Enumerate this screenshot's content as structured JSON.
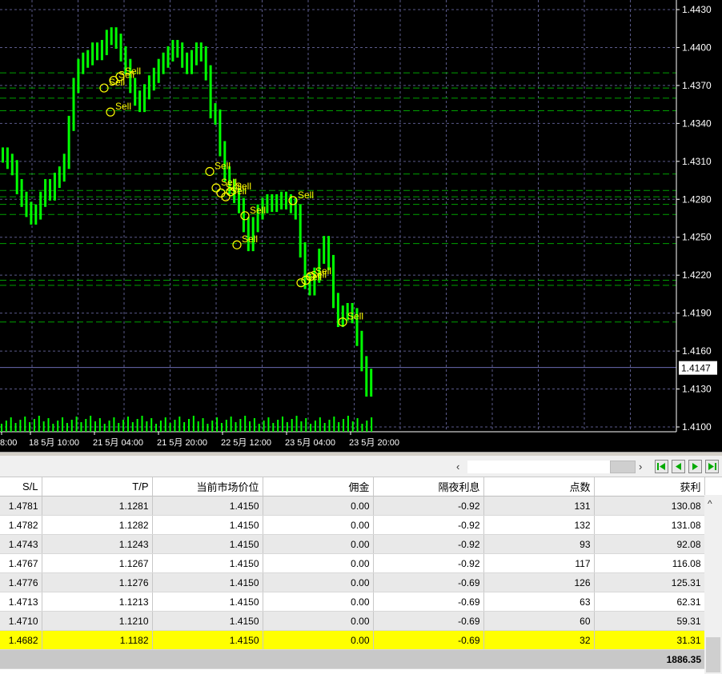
{
  "chart": {
    "price_ticks": [
      "1.4430",
      "1.4400",
      "1.4370",
      "1.4340",
      "1.4310",
      "1.4280",
      "1.4250",
      "1.4220",
      "1.4190",
      "1.4160",
      "1.4130",
      "1.4100"
    ],
    "current_price": "1.4147",
    "time_labels": [
      "8:00",
      "18 5月 10:00",
      "21 5月 04:00",
      "21 5月 20:00",
      "22 5月 12:00",
      "23 5月 04:00",
      "23 5月 20:00"
    ],
    "sell_label": "Sell",
    "colors": {
      "background": "#000000",
      "candles": "#00ff00",
      "grid": "#5a5a8a",
      "levels": "#00a000",
      "markers": "#ffff00",
      "axis_text": "#ffffff"
    }
  },
  "chart_data": {
    "type": "line",
    "ylim": [
      1.41,
      1.4445
    ],
    "prices": [
      1.4315,
      1.431,
      1.4305,
      1.429,
      1.428,
      1.4272,
      1.4266,
      1.427,
      1.428,
      1.429,
      1.4285,
      1.4295,
      1.43,
      1.431,
      1.434,
      1.437,
      1.4385,
      1.439,
      1.4392,
      1.4398,
      1.4396,
      1.44,
      1.4408,
      1.441,
      1.4405,
      1.4395,
      1.4385,
      1.437,
      1.436,
      1.4355,
      1.4365,
      1.4372,
      1.4378,
      1.4385,
      1.439,
      1.4395,
      1.44,
      1.4398,
      1.439,
      1.4385,
      1.4392,
      1.4398,
      1.4395,
      1.438,
      1.435,
      1.4345,
      1.432,
      1.43,
      1.429,
      1.4283,
      1.4275,
      1.426,
      1.4245,
      1.426,
      1.427,
      1.4275,
      1.4278,
      1.4276,
      1.4278,
      1.428,
      1.4278,
      1.4275,
      1.427,
      1.424,
      1.4215,
      1.421,
      1.422,
      1.4235,
      1.4245,
      1.423,
      1.42,
      1.4185,
      1.419,
      1.4192,
      1.4188,
      1.417,
      1.415,
      1.413,
      1.414
    ],
    "sell_levels": [
      1.4368,
      1.4374,
      1.4377,
      1.4349,
      1.4302,
      1.4289,
      1.4285,
      1.4282,
      1.4286,
      1.4267,
      1.4244,
      1.4279,
      1.4214,
      1.4216,
      1.4219,
      1.4183
    ],
    "level_lines": [
      1.438,
      1.4368,
      1.436,
      1.435,
      1.43,
      1.4287,
      1.4282,
      1.4276,
      1.4268,
      1.4245,
      1.4216,
      1.4212,
      1.4183
    ],
    "current_price": 1.4147
  },
  "table": {
    "headers": [
      "S/L",
      "T/P",
      "当前市场价位",
      "佣金",
      "隔夜利息",
      "点数",
      "获利"
    ],
    "rows": [
      [
        "1.4781",
        "1.1281",
        "1.4150",
        "0.00",
        "-0.92",
        "131",
        "130.08"
      ],
      [
        "1.4782",
        "1.1282",
        "1.4150",
        "0.00",
        "-0.92",
        "132",
        "131.08"
      ],
      [
        "1.4743",
        "1.1243",
        "1.4150",
        "0.00",
        "-0.92",
        "93",
        "92.08"
      ],
      [
        "1.4767",
        "1.1267",
        "1.4150",
        "0.00",
        "-0.92",
        "117",
        "116.08"
      ],
      [
        "1.4776",
        "1.1276",
        "1.4150",
        "0.00",
        "-0.69",
        "126",
        "125.31"
      ],
      [
        "1.4713",
        "1.1213",
        "1.4150",
        "0.00",
        "-0.69",
        "63",
        "62.31"
      ],
      [
        "1.4710",
        "1.1210",
        "1.4150",
        "0.00",
        "-0.69",
        "60",
        "59.31"
      ],
      [
        "1.4682",
        "1.1182",
        "1.4150",
        "0.00",
        "-0.69",
        "32",
        "31.31"
      ]
    ],
    "total": "1886.35",
    "highlight_color": "#ffff00"
  },
  "scrollbar": {
    "left_arrow": "‹",
    "right_arrow": "›",
    "up_arrow": "^"
  }
}
